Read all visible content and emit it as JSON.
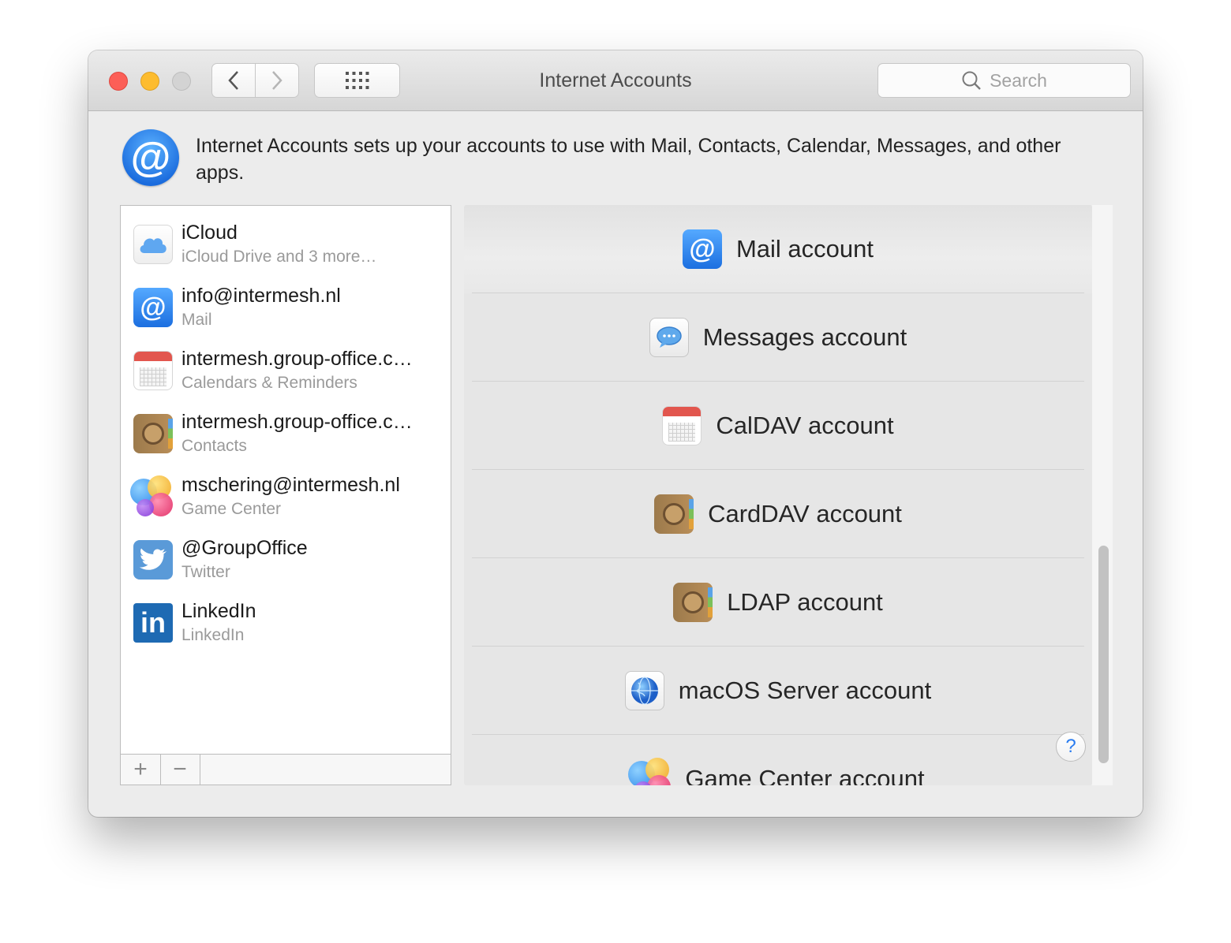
{
  "window": {
    "title": "Internet Accounts"
  },
  "search": {
    "placeholder": "Search",
    "icon": "magnifier-icon"
  },
  "header": {
    "text": "Internet Accounts sets up your accounts to use with Mail, Contacts, Calendar, Messages, and other apps.",
    "icon": "at-sign-icon"
  },
  "accounts": [
    {
      "name": "iCloud",
      "detail": "iCloud Drive and 3 more…",
      "icon": "icloud-icon"
    },
    {
      "name": "info@intermesh.nl",
      "detail": "Mail",
      "icon": "mail-at-icon"
    },
    {
      "name": "intermesh.group-office.c…",
      "detail": "Calendars & Reminders",
      "icon": "calendar-icon"
    },
    {
      "name": "intermesh.group-office.c…",
      "detail": "Contacts",
      "icon": "contacts-icon"
    },
    {
      "name": "mschering@intermesh.nl",
      "detail": "Game Center",
      "icon": "game-center-icon"
    },
    {
      "name": "@GroupOffice",
      "detail": "Twitter",
      "icon": "twitter-icon"
    },
    {
      "name": "LinkedIn",
      "detail": "LinkedIn",
      "icon": "linkedin-icon"
    }
  ],
  "list_buttons": {
    "add": "+",
    "remove": "−"
  },
  "providers": [
    {
      "label": "Mail account",
      "icon": "mail-at-icon"
    },
    {
      "label": "Messages account",
      "icon": "messages-icon"
    },
    {
      "label": "CalDAV account",
      "icon": "calendar-icon"
    },
    {
      "label": "CardDAV account",
      "icon": "contacts-icon"
    },
    {
      "label": "LDAP account",
      "icon": "contacts-icon"
    },
    {
      "label": "macOS Server account",
      "icon": "server-globe-icon"
    },
    {
      "label": "Game Center account",
      "icon": "game-center-icon"
    }
  ],
  "help": {
    "label": "?"
  },
  "colors": {
    "accent": "#1c6fe0",
    "close": "#fc5f57",
    "minimize": "#fdbc2e",
    "zoom_disabled": "#d3d3d3"
  }
}
